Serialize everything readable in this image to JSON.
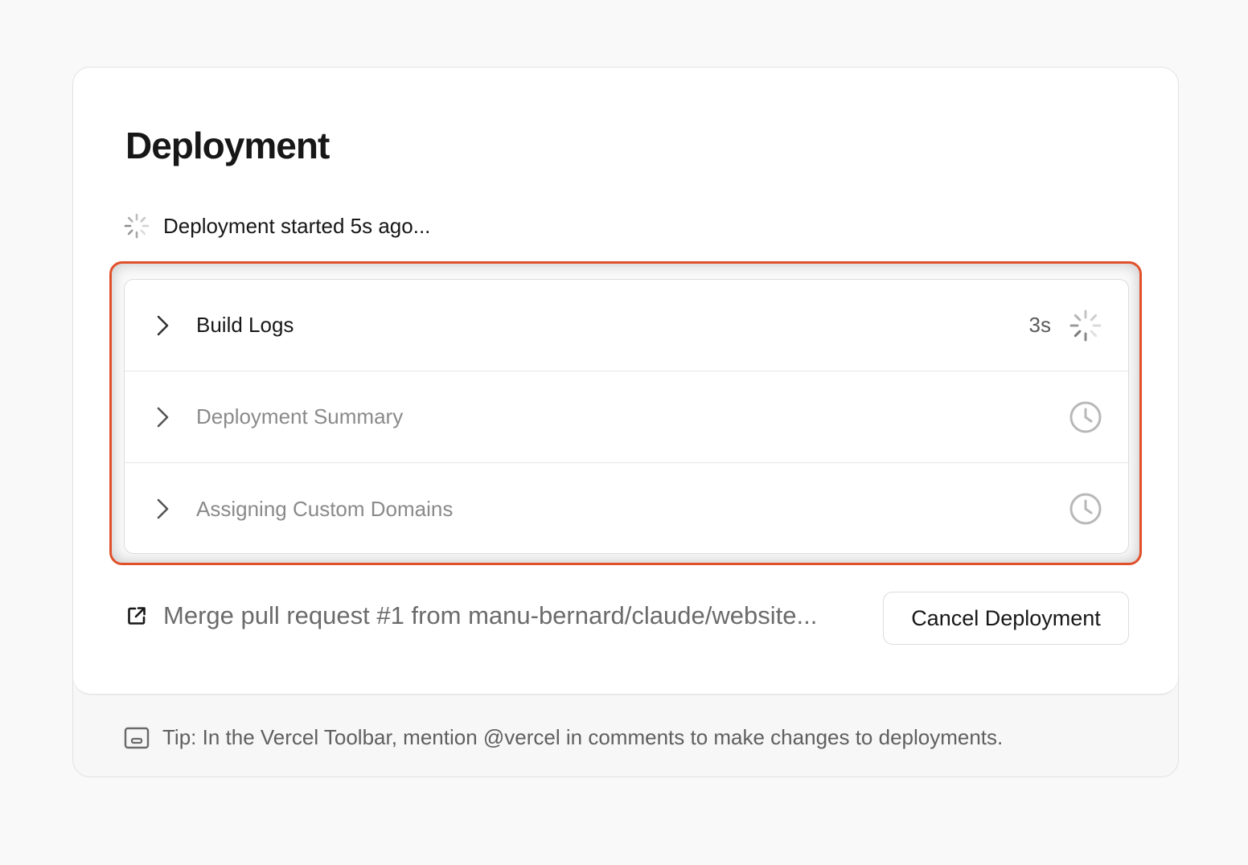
{
  "title": "Deployment",
  "status": {
    "text": "Deployment started 5s ago...",
    "icon": "spinner-icon"
  },
  "steps": [
    {
      "label": "Build Logs",
      "time": "3s",
      "state": "running",
      "icon": "spinner-icon"
    },
    {
      "label": "Deployment Summary",
      "time": "",
      "state": "pending",
      "icon": "clock-icon"
    },
    {
      "label": "Assigning Custom Domains",
      "time": "",
      "state": "pending",
      "icon": "clock-icon"
    }
  ],
  "commit": {
    "text": "Merge pull request #1 from manu-bernard/claude/website...",
    "icon": "external-link-icon"
  },
  "cancel_button": "Cancel Deployment",
  "tip": {
    "text": "Tip: In the Vercel Toolbar, mention @vercel in comments to make changes to deployments.",
    "icon": "toolbar-icon"
  },
  "colors": {
    "highlight_border": "#e0502a",
    "pending_text": "#8a8a8a",
    "primary_text": "#171717"
  }
}
